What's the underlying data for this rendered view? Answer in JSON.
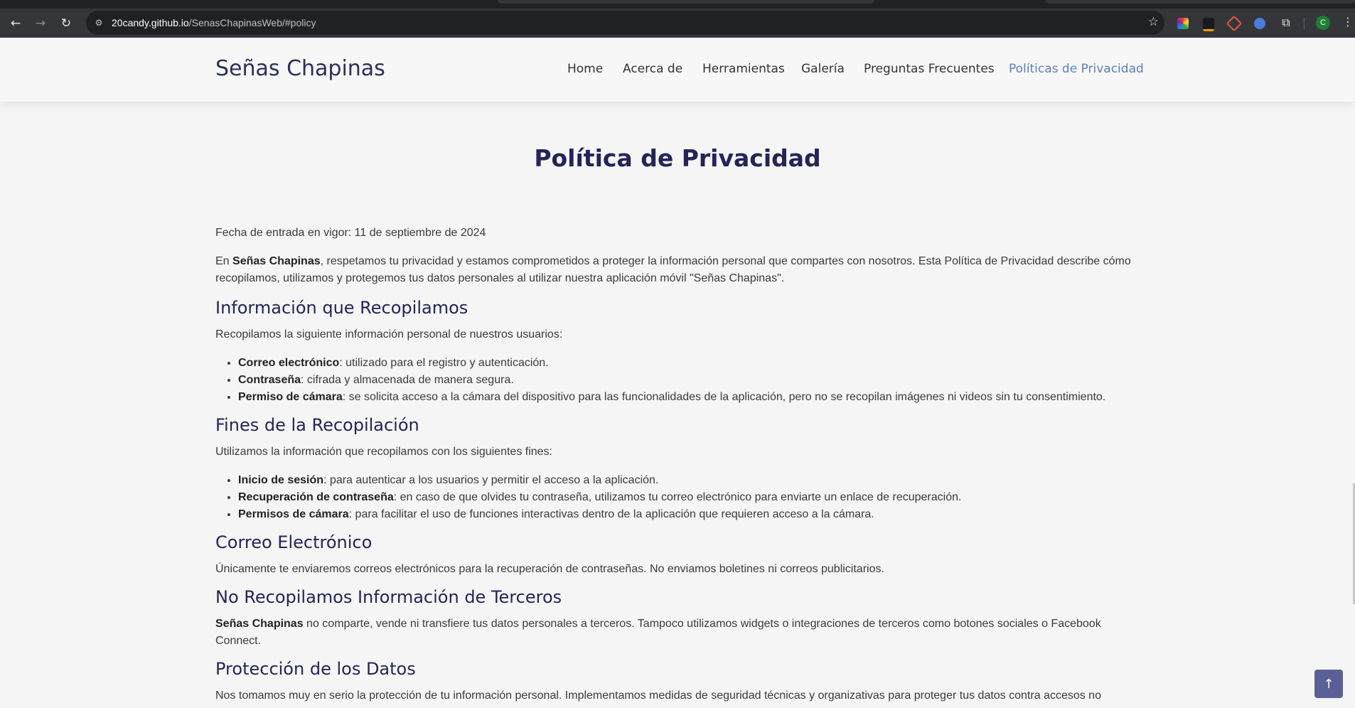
{
  "browser": {
    "url_host": "20candy.github.io",
    "url_path": "/SenasChapinasWeb/#policy",
    "back_icon": "arrow-left-icon",
    "forward_icon": "arrow-right-icon",
    "reload_icon": "reload-icon",
    "bookmark_icon": "star-icon",
    "extensions_icon": "puzzle-icon",
    "profile_initial": "C"
  },
  "header": {
    "logo": "Señas Chapinas",
    "nav": {
      "home": "Home",
      "about": "Acerca de",
      "tools": "Herramientas",
      "gallery": "Galería",
      "faq": "Preguntas Frecuentes",
      "privacy": "Políticas de Privacidad"
    },
    "active_color": "#5b7fc0"
  },
  "page": {
    "title": "Política de Privacidad",
    "effective_date": "Fecha de entrada en vigor: 11 de septiembre de 2024",
    "intro": {
      "pre": "En ",
      "brand": "Señas Chapinas",
      "line1_rest": ", respetamos tu privacidad y estamos comprometidos a proteger la información personal que compartes con nosotros. Esta Política de Privacidad describe cómo",
      "line2": "recopilamos, utilizamos y protegemos tus datos personales al utilizar nuestra aplicación móvil \"Señas Chapinas\"."
    },
    "sections": {
      "collected": {
        "heading": "Información que Recopilamos",
        "lead": "Recopilamos la siguiente información personal de nuestros usuarios:",
        "items": [
          {
            "term": "Correo electrónico",
            "text": ": utilizado para el registro y autenticación."
          },
          {
            "term": "Contraseña",
            "text": ": cifrada y almacenada de manera segura."
          },
          {
            "term": "Permiso de cámara",
            "text": ": se solicita acceso a la cámara del dispositivo para las funcionalidades de la aplicación, pero no se recopilan imágenes ni videos sin tu consentimiento."
          }
        ]
      },
      "purposes": {
        "heading": "Fines de la Recopilación",
        "lead": "Utilizamos la información que recopilamos con los siguientes fines:",
        "items": [
          {
            "term": "Inicio de sesión",
            "text": ": para autenticar a los usuarios y permitir el acceso a la aplicación."
          },
          {
            "term": "Recuperación de contraseña",
            "text": ": en caso de que olvides tu contraseña, utilizamos tu correo electrónico para enviarte un enlace de recuperación."
          },
          {
            "term": "Permisos de cámara",
            "text": ": para facilitar el uso de funciones interactivas dentro de la aplicación que requieren acceso a la cámara."
          }
        ]
      },
      "email": {
        "heading": "Correo Electrónico",
        "text": "Únicamente te enviaremos correos electrónicos para la recuperación de contraseñas. No enviamos boletines ni correos publicitarios."
      },
      "third_parties": {
        "heading": "No Recopilamos Información de Terceros",
        "brand": "Señas Chapinas",
        "line1_rest": " no comparte, vende ni transfiere tus datos personales a terceros. Tampoco utilizamos widgets o integraciones de terceros como botones sociales o Facebook",
        "line2": "Connect."
      },
      "protection": {
        "heading": "Protección de los Datos",
        "text": "Nos tomamos muy en serio la protección de tu información personal. Implementamos medidas de seguridad técnicas y organizativas para proteger tus datos contra accesos no"
      }
    }
  },
  "scroll_top_icon": "arrow-up-icon"
}
